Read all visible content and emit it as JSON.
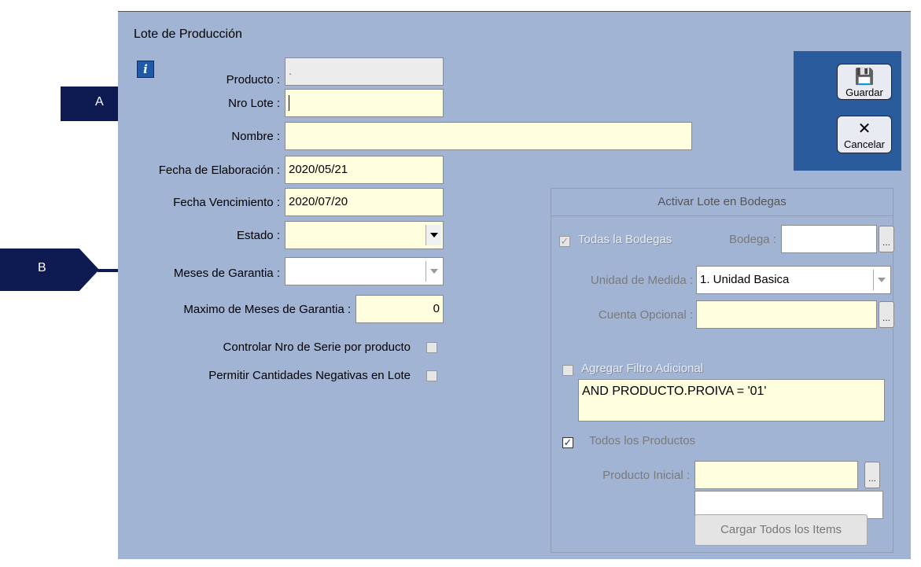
{
  "window": {
    "title": "Lote de Producción"
  },
  "toolbar": {
    "save_label": "Guardar",
    "cancel_label": "Cancelar"
  },
  "form": {
    "producto": {
      "label": "Producto :",
      "value": "."
    },
    "nro_lote": {
      "label": "Nro Lote :",
      "value": ""
    },
    "nombre": {
      "label": "Nombre :",
      "value": ""
    },
    "fecha_elaboracion": {
      "label": "Fecha de Elaboración :",
      "value": "2020/05/21"
    },
    "fecha_vencimiento": {
      "label": "Fecha Vencimiento :",
      "value": "2020/07/20"
    },
    "estado": {
      "label": "Estado :",
      "value": ""
    },
    "meses_garantia": {
      "label": "Meses  de  Garantia :",
      "value": ""
    },
    "max_meses_garantia": {
      "label": "Maximo de Meses  de  Garantia :",
      "value": "0"
    },
    "controlar_serie": {
      "label": "Controlar Nro de Serie por producto",
      "checked": false
    },
    "permitir_negativas": {
      "label": "Permitir Cantidades Negativas en Lote",
      "checked": false
    }
  },
  "bodegas": {
    "title": "Activar Lote en Bodegas",
    "todas_bodegas": {
      "label": "Todas la Bodegas",
      "checked": true
    },
    "bodega": {
      "label": "Bodega :",
      "value": ""
    },
    "unidad_medida": {
      "label": "Unidad de Medida :",
      "value": "1. Unidad Basica"
    },
    "cuenta_opcional": {
      "label": "Cuenta Opcional :",
      "value": ""
    },
    "agregar_filtro": {
      "label": "Agregar Filtro Adicional",
      "checked": false
    },
    "filtro_text": "AND PRODUCTO.PROIVA = '01'",
    "todos_productos": {
      "label": "Todos los Productos",
      "checked": true
    },
    "producto_inicial": {
      "label": "Producto Inicial :",
      "value": ""
    },
    "producto_final_value": "",
    "load_button": "Cargar Todos los Items"
  },
  "annotations": {
    "a": "A",
    "b": "B"
  },
  "colors": {
    "window_bg": "#a2b4d4",
    "field_bg": "#ffffe0",
    "toolbar_bg": "#2a5b9d",
    "callout": "#0e1a52"
  }
}
